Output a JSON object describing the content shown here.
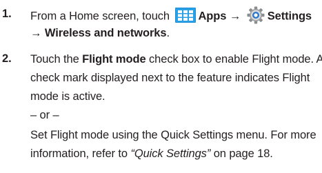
{
  "steps": [
    {
      "number": "1.",
      "line1": {
        "pre": "From a Home screen, touch",
        "apps": "Apps",
        "arrow": "→",
        "settings": "Settings"
      },
      "line2": "→ Wireless and networks",
      "line2_end": "."
    },
    {
      "number": "2.",
      "l1_a": "Touch the ",
      "l1_b": "Flight mode",
      "l1_c": " check box to enable Flight mode. A",
      "l2": "check mark displayed next to the feature indicates Flight",
      "l3": "mode is active.",
      "or": "– or –",
      "l5": "Set Flight mode using the Quick Settings menu. For more",
      "l6_a": "information, refer to ",
      "l6_b": "“Quick Settings”",
      "l6_c": " on page 18."
    }
  ],
  "icons": {
    "apps": "apps-grid-icon",
    "settings": "settings-gear-icon"
  },
  "colors": {
    "text": "#231f20",
    "apps_icon": "#1c8fd6"
  }
}
